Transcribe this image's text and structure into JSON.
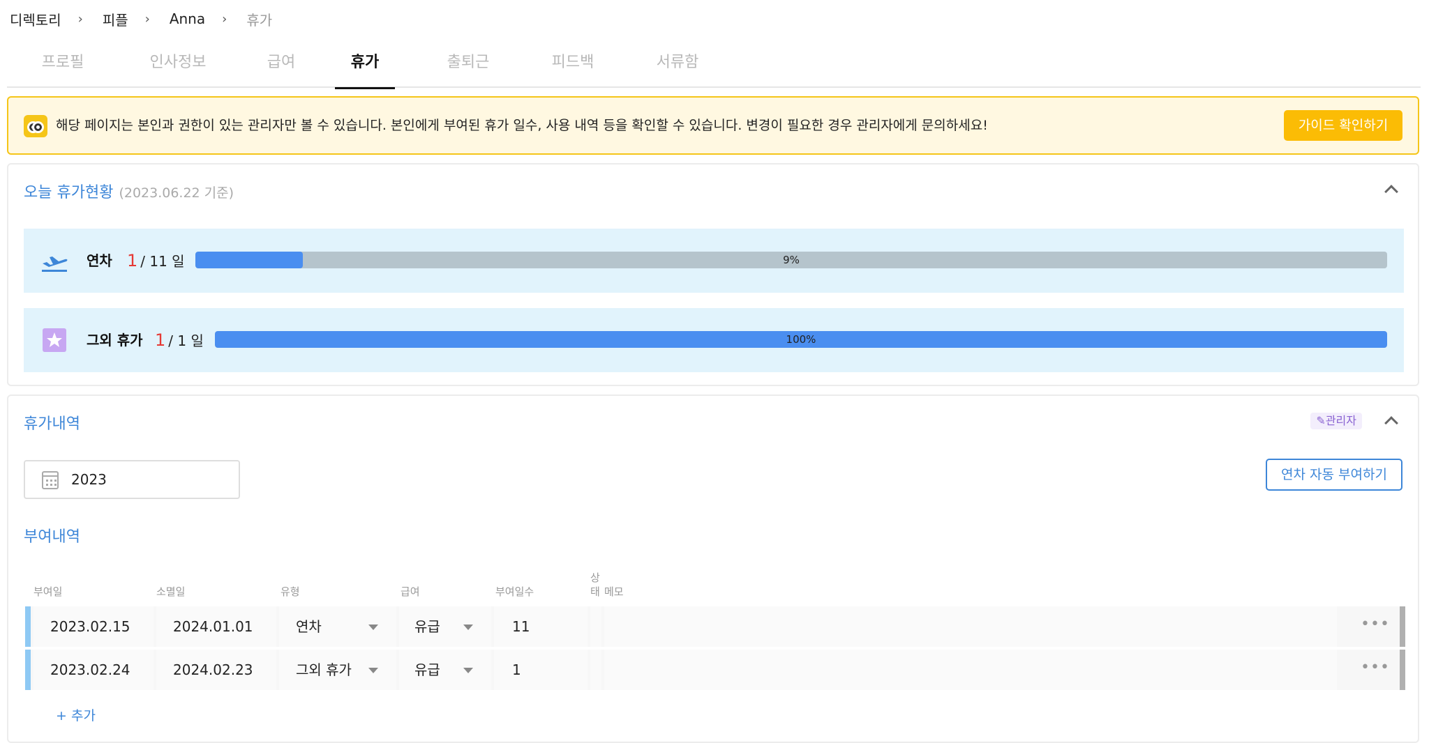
{
  "breadcrumb": [
    "디렉토리",
    "피플",
    "Anna",
    "휴가"
  ],
  "tabs": [
    "프로필",
    "인사정보",
    "급여",
    "휴가",
    "출퇴근",
    "피드백",
    "서류함"
  ],
  "active_tab": "휴가",
  "notice": {
    "message": "해당 페이지는 본인과 권한이 있는 관리자만 볼 수 있습니다. 본인에게 부여된 휴가 일수, 사용 내역 등을 확인할 수 있습니다. 변경이 필요한 경우 관리자에게 문의하세요!",
    "button": "가이드 확인하기"
  },
  "today": {
    "title": "오늘 휴가현황",
    "subtitle": "(2023.06.22 기준)",
    "rows": [
      {
        "icon": "airplane-takeoff-icon",
        "label": "연차",
        "used": "1",
        "total": "/ 11 일",
        "percent_text": "9%",
        "fill_fraction": 0.09
      },
      {
        "icon": "star-icon",
        "label": "그외 휴가",
        "used": "1",
        "total": "/ 1 일",
        "percent_text": "100%",
        "fill_fraction": 1.0
      }
    ]
  },
  "history": {
    "title": "휴가내역",
    "admin_badge": "관리자",
    "year": "2023",
    "auto_button": "연차 자동 부여하기",
    "grant_title": "부여내역",
    "headers": {
      "grant_date": "부여일",
      "expire_date": "소멸일",
      "type": "유형",
      "pay": "급여",
      "days": "부여일수",
      "status": "상",
      "status2": "태",
      "memo": "메모"
    },
    "rows": [
      {
        "grant_date": "2023.02.15",
        "expire_date": "2024.01.01",
        "type": "연차",
        "pay": "유급",
        "days": "11"
      },
      {
        "grant_date": "2023.02.24",
        "expire_date": "2024.02.23",
        "type": "그외 휴가",
        "pay": "유급",
        "days": "1"
      }
    ],
    "add_link": "+ 추가"
  },
  "colors": {
    "accent": "#3d86d8",
    "progress_fill": "#4a8ef0",
    "progress_track": "#b5c4cc",
    "notice_bg": "#fff8e1",
    "notice_border": "#f5c518",
    "guide_button": "#fbbc05",
    "used_count": "#e53935"
  }
}
